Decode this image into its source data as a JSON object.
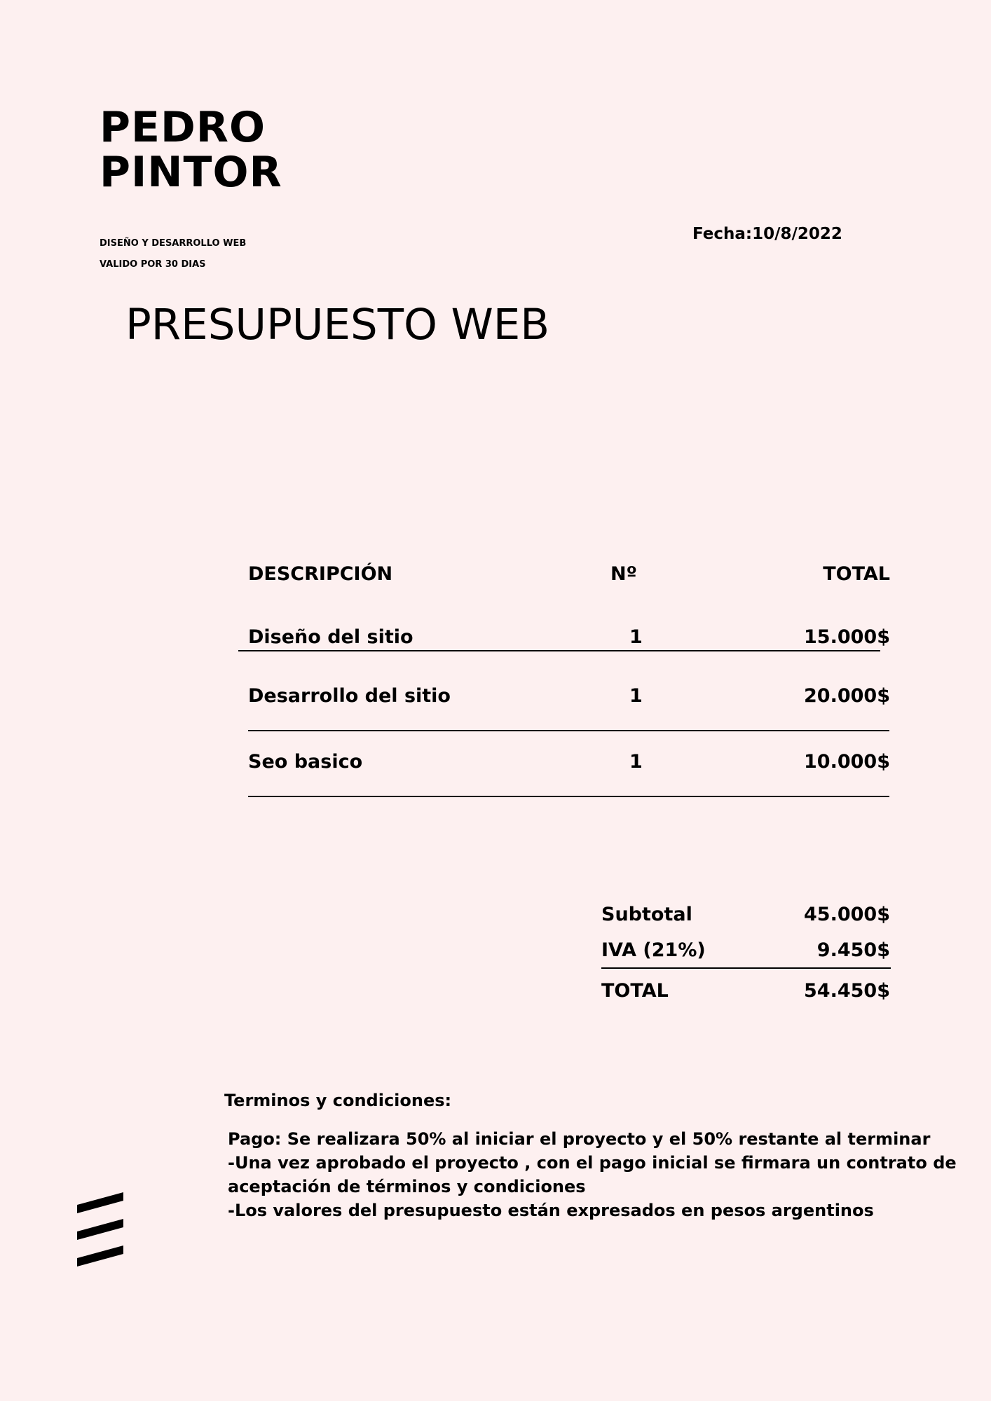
{
  "header": {
    "brand_line1": "PEDRO",
    "brand_line2": "PINTOR",
    "tagline": "DISEÑO Y DESARROLLO WEB",
    "validity": "VALIDO POR 30 DIAS",
    "date": "Fecha:10/8/2022",
    "title": "PRESUPUESTO WEB"
  },
  "table": {
    "headers": {
      "description": "DESCRIPCIÓN",
      "quantity": "Nº",
      "total": "TOTAL"
    },
    "rows": [
      {
        "description": "Diseño del sitio",
        "quantity": "1",
        "total": "15.000$"
      },
      {
        "description": "Desarrollo del sitio",
        "quantity": "1",
        "total": "20.000$"
      },
      {
        "description": "Seo basico",
        "quantity": "1",
        "total": "10.000$"
      }
    ]
  },
  "summary": {
    "subtotal_label": "Subtotal",
    "subtotal_value": "45.000$",
    "tax_label": "IVA (21%)",
    "tax_value": "9.450$",
    "total_label": "TOTAL",
    "total_value": "54.450$"
  },
  "terms": {
    "title": "Terminos y condiciones:",
    "lines": [
      "Pago: Se realizara 50% al iniciar el proyecto y el 50% restante al terminar",
      "-Una vez aprobado el proyecto , con el pago inicial se firmara un contrato de",
      "aceptación de términos y condiciones",
      "-Los valores del presupuesto están expresados en pesos argentinos"
    ]
  },
  "decoration": {
    "stripes_icon": "diagonal-stripes-icon",
    "color": "#000000"
  }
}
